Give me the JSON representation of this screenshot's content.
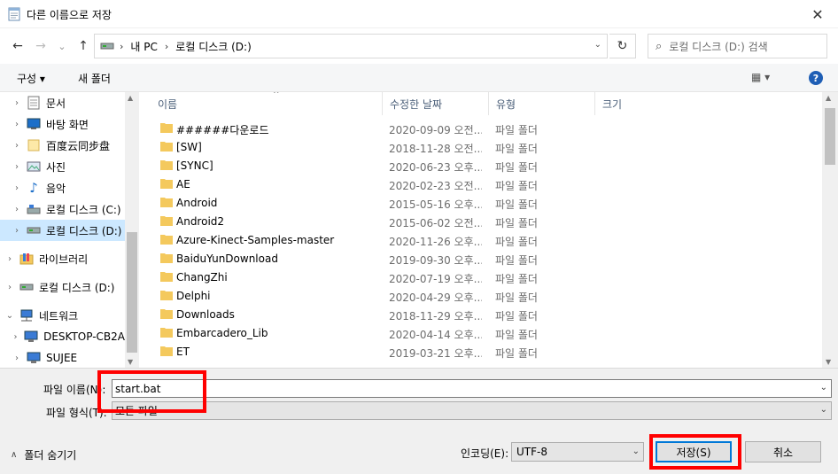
{
  "window": {
    "title": "다른 이름으로 저장",
    "close_glyph": "✕"
  },
  "nav": {
    "back": "←",
    "forward": "→",
    "down": "⌄",
    "up": "↑"
  },
  "address": {
    "parts": [
      "내 PC",
      "로컬 디스크 (D:)"
    ],
    "sep": "›",
    "dropdown": "⌄",
    "refresh": "↻"
  },
  "search": {
    "placeholder": "로컬 디스크 (D:) 검색",
    "icon": "⌕"
  },
  "toolbar": {
    "organize": "구성 ▾",
    "new_folder": "새 폴더",
    "view": "▦ ▾",
    "help": "?"
  },
  "navpane": {
    "items": [
      {
        "label": "문서",
        "icon": "document-icon",
        "chev": "›"
      },
      {
        "label": "바탕 화면",
        "icon": "desktop-icon",
        "chev": "›"
      },
      {
        "label": "百度云同步盘",
        "icon": "folder-icon",
        "chev": "›"
      },
      {
        "label": "사진",
        "icon": "pictures-icon",
        "chev": "›"
      },
      {
        "label": "음악",
        "icon": "music-icon",
        "chev": "›"
      },
      {
        "label": "로컬 디스크 (C:)",
        "icon": "drive-c-icon",
        "chev": "›"
      },
      {
        "label": "로컬 디스크 (D:)",
        "icon": "drive-d-icon",
        "chev": "›",
        "selected": true
      },
      {
        "label": "라이브러리",
        "icon": "library-icon",
        "chev": "›"
      },
      {
        "label": "로컬 디스크 (D:)",
        "icon": "drive-d-icon",
        "chev": "›"
      },
      {
        "label": "네트워크",
        "icon": "network-icon",
        "chev": "⌄"
      },
      {
        "label": "DESKTOP-CB2A",
        "icon": "computer-icon",
        "chev": "›"
      },
      {
        "label": "SUJEE",
        "icon": "computer-icon",
        "chev": "›"
      }
    ]
  },
  "columns": {
    "name": "이름",
    "date": "수정한 날짜",
    "type": "유형",
    "size": "크기"
  },
  "files": [
    {
      "name": "######다운로드",
      "date": "2020-09-09 오전...",
      "type": "파일 폴더"
    },
    {
      "name": "[SW]",
      "date": "2018-11-28 오전...",
      "type": "파일 폴더"
    },
    {
      "name": "[SYNC]",
      "date": "2020-06-23 오후...",
      "type": "파일 폴더"
    },
    {
      "name": "AE",
      "date": "2020-02-23 오전...",
      "type": "파일 폴더"
    },
    {
      "name": "Android",
      "date": "2015-05-16 오후...",
      "type": "파일 폴더"
    },
    {
      "name": "Android2",
      "date": "2015-06-02 오전...",
      "type": "파일 폴더"
    },
    {
      "name": "Azure-Kinect-Samples-master",
      "date": "2020-11-26 오후...",
      "type": "파일 폴더"
    },
    {
      "name": "BaiduYunDownload",
      "date": "2019-09-30 오후...",
      "type": "파일 폴더"
    },
    {
      "name": "ChangZhi",
      "date": "2020-07-19 오후...",
      "type": "파일 폴더"
    },
    {
      "name": "Delphi",
      "date": "2020-04-29 오후...",
      "type": "파일 폴더"
    },
    {
      "name": "Downloads",
      "date": "2018-11-29 오후...",
      "type": "파일 폴더"
    },
    {
      "name": "Embarcadero_Lib",
      "date": "2020-04-14 오후...",
      "type": "파일 폴더"
    },
    {
      "name": "ET",
      "date": "2019-03-21 오후...",
      "type": "파일 폴더"
    }
  ],
  "fields": {
    "filename_label": "파일 이름(N):",
    "filename_value": "start.bat",
    "filetype_label": "파일 형식(T):",
    "filetype_value": "모든 파일",
    "dropdown": "⌄"
  },
  "footer": {
    "hide_folders": "폴더 숨기기",
    "hide_chev": "∧",
    "encoding_label": "인코딩(E):",
    "encoding_value": "UTF-8",
    "save": "저장(S)",
    "cancel": "취소"
  },
  "colors": {
    "folder": "#f4c95d",
    "selection": "#cce8ff",
    "highlight": "#ff0000",
    "accent": "#0078d7"
  }
}
